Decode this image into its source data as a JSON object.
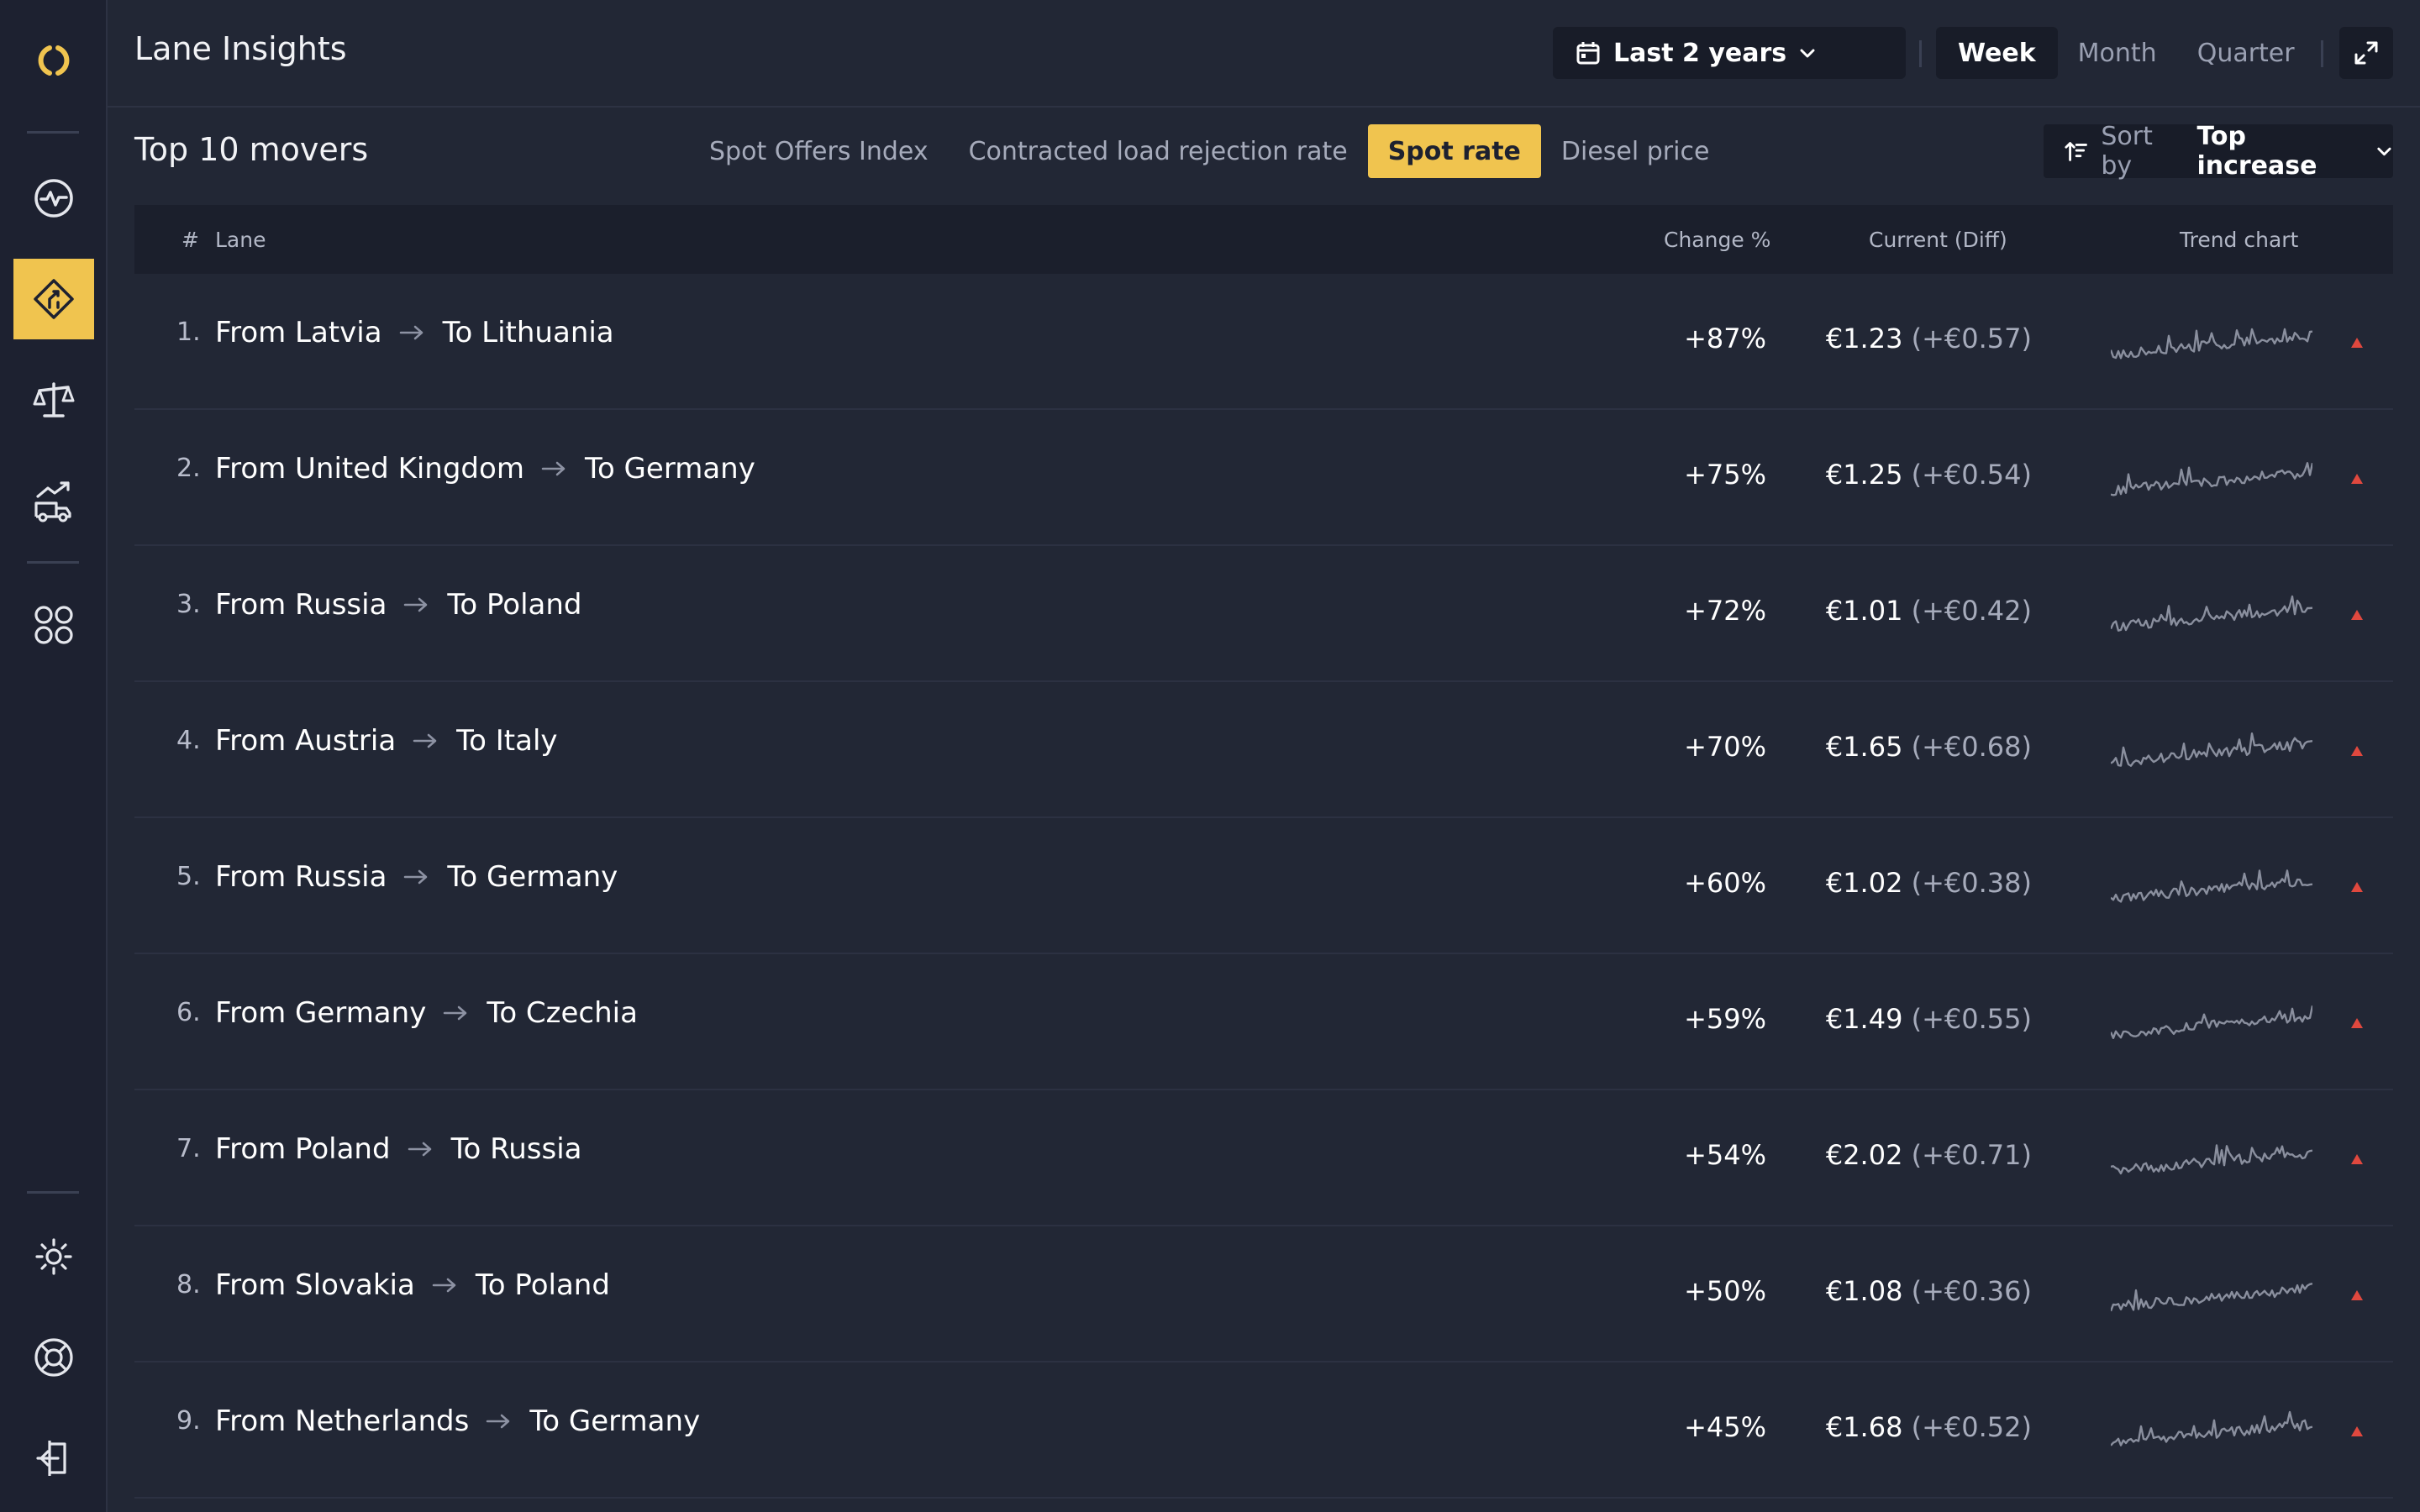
{
  "app": {
    "title": "Lane Insights"
  },
  "sidebar": {
    "items": [
      {
        "icon": "logo-icon"
      },
      {
        "icon": "pulse-icon"
      },
      {
        "icon": "road-sign-icon"
      },
      {
        "icon": "scales-icon"
      },
      {
        "icon": "truck-trend-icon"
      },
      {
        "icon": "apps-grid-icon"
      },
      {
        "icon": "sun-icon"
      },
      {
        "icon": "lifebuoy-icon"
      },
      {
        "icon": "logout-icon"
      }
    ],
    "active_index": 2
  },
  "header": {
    "date_range": "Last 2 years",
    "periods": [
      "Week",
      "Month",
      "Quarter"
    ],
    "active_period": "Week"
  },
  "section": {
    "title": "Top 10 movers",
    "metric_tabs": [
      "Spot Offers Index",
      "Contracted load rejection rate",
      "Spot rate",
      "Diesel price"
    ],
    "active_metric": "Spot rate",
    "sort_prefix": "Sort by",
    "sort_value": "Top increase"
  },
  "table": {
    "columns": {
      "rank": "#",
      "lane": "Lane",
      "change": "Change %",
      "current": "Current (Diff)",
      "trend": "Trend chart"
    },
    "rows": [
      {
        "rank": "1.",
        "from": "From Latvia",
        "to": "To Lithuania",
        "change": "+87%",
        "current": "€1.23",
        "diff": "(+€0.57)"
      },
      {
        "rank": "2.",
        "from": "From United Kingdom",
        "to": "To Germany",
        "change": "+75%",
        "current": "€1.25",
        "diff": "(+€0.54)"
      },
      {
        "rank": "3.",
        "from": "From Russia",
        "to": "To Poland",
        "change": "+72%",
        "current": "€1.01",
        "diff": "(+€0.42)"
      },
      {
        "rank": "4.",
        "from": "From Austria",
        "to": "To Italy",
        "change": "+70%",
        "current": "€1.65",
        "diff": "(+€0.68)"
      },
      {
        "rank": "5.",
        "from": "From Russia",
        "to": "To Germany",
        "change": "+60%",
        "current": "€1.02",
        "diff": "(+€0.38)"
      },
      {
        "rank": "6.",
        "from": "From Germany",
        "to": "To Czechia",
        "change": "+59%",
        "current": "€1.49",
        "diff": "(+€0.55)"
      },
      {
        "rank": "7.",
        "from": "From Poland",
        "to": "To Russia",
        "change": "+54%",
        "current": "€2.02",
        "diff": "(+€0.71)"
      },
      {
        "rank": "8.",
        "from": "From Slovakia",
        "to": "To Poland",
        "change": "+50%",
        "current": "€1.08",
        "diff": "(+€0.36)"
      },
      {
        "rank": "9.",
        "from": "From Netherlands",
        "to": "To Germany",
        "change": "+45%",
        "current": "€1.68",
        "diff": "(+€0.52)"
      }
    ]
  },
  "colors": {
    "accent": "#f0c44f",
    "background": "#222735",
    "sidebar": "#1d2130",
    "up_indicator": "#e0483e",
    "sparkline": "#8a8f9e"
  }
}
